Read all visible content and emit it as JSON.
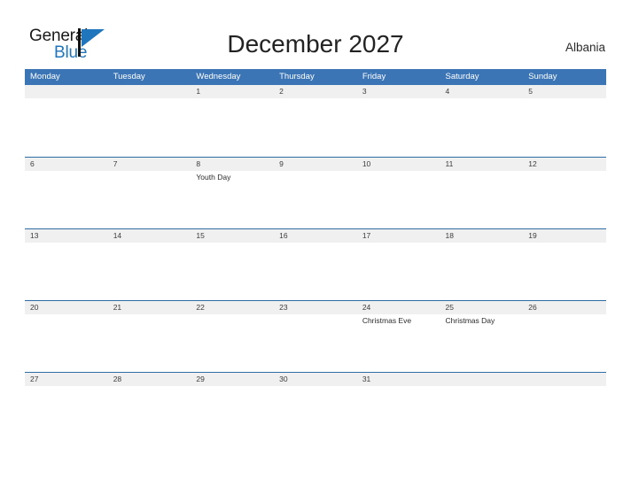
{
  "brand": {
    "name_part1": "General",
    "name_part2": "Blue",
    "flag_icon": "blue-flag-triangle-icon",
    "accent_color": "#1f76bd"
  },
  "header": {
    "title": "December 2027",
    "country": "Albania"
  },
  "colors": {
    "header_blue": "#3b75b6",
    "row_stripe": "#f0f0f0",
    "row_border": "#2e6da4",
    "page_background": "#ffffff"
  },
  "calendar": {
    "month": "December",
    "year": "2027",
    "weekday_headers": [
      "Monday",
      "Tuesday",
      "Wednesday",
      "Thursday",
      "Friday",
      "Saturday",
      "Sunday"
    ],
    "weeks": [
      [
        {
          "date": "",
          "events": []
        },
        {
          "date": "",
          "events": []
        },
        {
          "date": "1",
          "events": []
        },
        {
          "date": "2",
          "events": []
        },
        {
          "date": "3",
          "events": []
        },
        {
          "date": "4",
          "events": []
        },
        {
          "date": "5",
          "events": []
        }
      ],
      [
        {
          "date": "6",
          "events": []
        },
        {
          "date": "7",
          "events": []
        },
        {
          "date": "8",
          "events": [
            "Youth Day"
          ]
        },
        {
          "date": "9",
          "events": []
        },
        {
          "date": "10",
          "events": []
        },
        {
          "date": "11",
          "events": []
        },
        {
          "date": "12",
          "events": []
        }
      ],
      [
        {
          "date": "13",
          "events": []
        },
        {
          "date": "14",
          "events": []
        },
        {
          "date": "15",
          "events": []
        },
        {
          "date": "16",
          "events": []
        },
        {
          "date": "17",
          "events": []
        },
        {
          "date": "18",
          "events": []
        },
        {
          "date": "19",
          "events": []
        }
      ],
      [
        {
          "date": "20",
          "events": []
        },
        {
          "date": "21",
          "events": []
        },
        {
          "date": "22",
          "events": []
        },
        {
          "date": "23",
          "events": []
        },
        {
          "date": "24",
          "events": [
            "Christmas Eve"
          ]
        },
        {
          "date": "25",
          "events": [
            "Christmas Day"
          ]
        },
        {
          "date": "26",
          "events": []
        }
      ],
      [
        {
          "date": "27",
          "events": []
        },
        {
          "date": "28",
          "events": []
        },
        {
          "date": "29",
          "events": []
        },
        {
          "date": "30",
          "events": []
        },
        {
          "date": "31",
          "events": []
        },
        {
          "date": "",
          "events": []
        },
        {
          "date": "",
          "events": []
        }
      ]
    ]
  }
}
